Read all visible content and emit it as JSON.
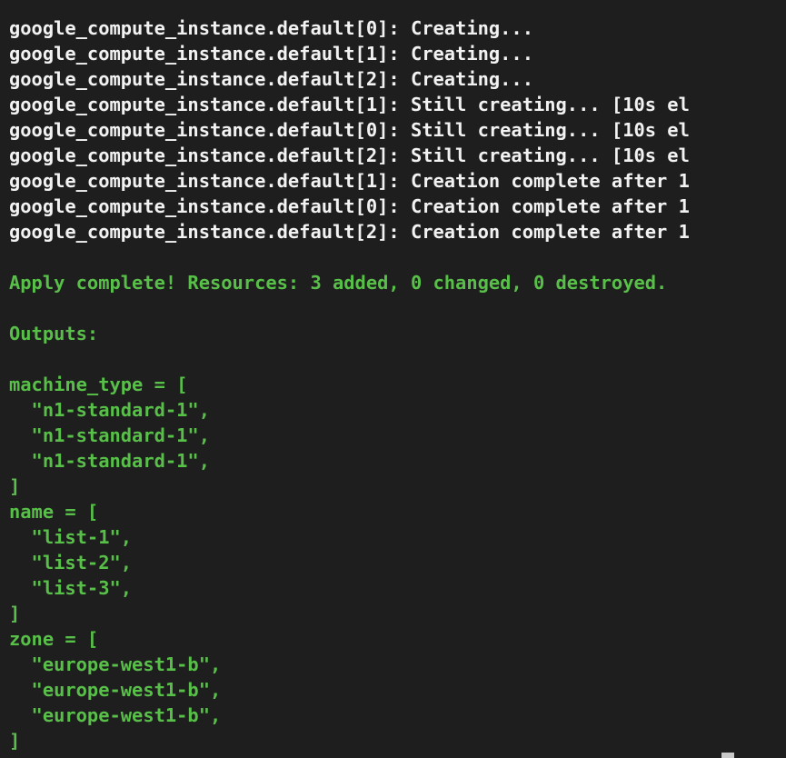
{
  "terminal": {
    "colors": {
      "background": "#1e1e1e",
      "log_text": "#f2f2f2",
      "output_text": "#58c049",
      "cursor": "#c9c9c9"
    },
    "apply_log": [
      "google_compute_instance.default[0]: Creating...",
      "google_compute_instance.default[1]: Creating...",
      "google_compute_instance.default[2]: Creating...",
      "google_compute_instance.default[1]: Still creating... [10s el",
      "google_compute_instance.default[0]: Still creating... [10s el",
      "google_compute_instance.default[2]: Still creating... [10s el",
      "google_compute_instance.default[1]: Creation complete after 1",
      "google_compute_instance.default[0]: Creation complete after 1",
      "google_compute_instance.default[2]: Creation complete after 1"
    ],
    "apply_summary": "Apply complete! Resources: 3 added, 0 changed, 0 destroyed.",
    "outputs_header": "Outputs:",
    "outputs": {
      "machine_type": {
        "open": "machine_type = [",
        "items": [
          "  \"n1-standard-1\",",
          "  \"n1-standard-1\",",
          "  \"n1-standard-1\","
        ],
        "close": "]"
      },
      "name": {
        "open": "name = [",
        "items": [
          "  \"list-1\",",
          "  \"list-2\",",
          "  \"list-3\","
        ],
        "close": "]"
      },
      "zone": {
        "open": "zone = [",
        "items": [
          "  \"europe-west1-b\",",
          "  \"europe-west1-b\",",
          "  \"europe-west1-b\","
        ],
        "close": "]"
      }
    }
  }
}
